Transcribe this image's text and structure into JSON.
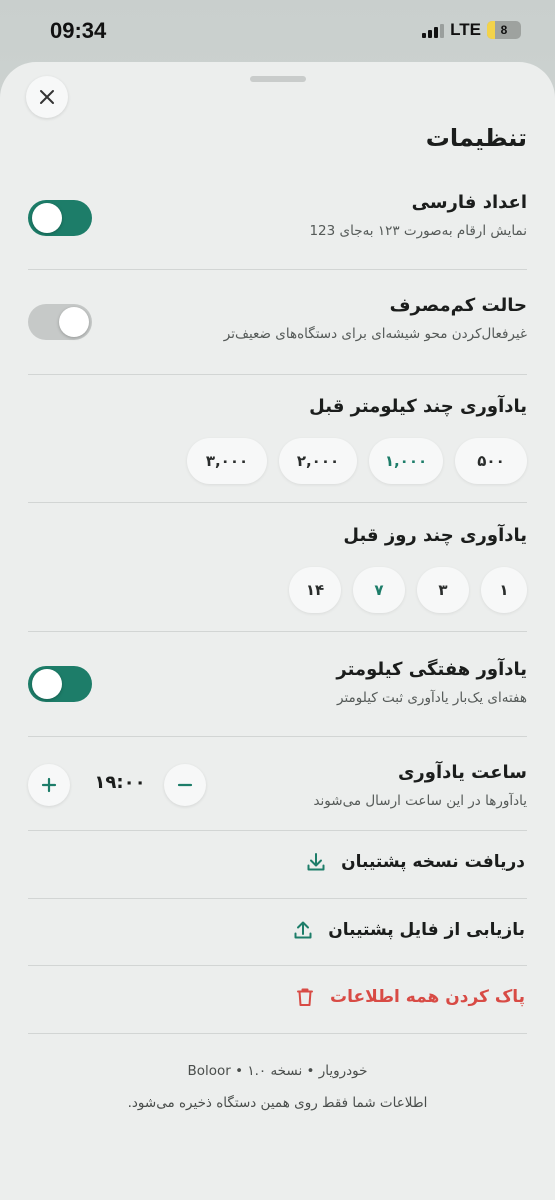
{
  "status_bar": {
    "time": "09:34",
    "network": "LTE",
    "battery": "8"
  },
  "sheet": {
    "title": "تنظیمات"
  },
  "persian_digits": {
    "label": "اعداد فارسی",
    "description": "نمایش ارقام به‌صورت ۱۲۳ به‌جای 123",
    "enabled": true
  },
  "low_power": {
    "label": "حالت کم‌مصرف",
    "description": "غیرفعال‌کردن محو شیشه‌ای برای دستگاه‌های ضعیف‌تر",
    "enabled": false
  },
  "km_reminder": {
    "label": "یادآوری چند کیلومتر قبل",
    "options": [
      "۵۰۰",
      "۱,۰۰۰",
      "۲,۰۰۰",
      "۳,۰۰۰"
    ],
    "selected": "۱,۰۰۰"
  },
  "day_reminder": {
    "label": "یادآوری چند روز قبل",
    "options": [
      "۱",
      "۳",
      "۷",
      "۱۴"
    ],
    "selected": "۷"
  },
  "weekly_km": {
    "label": "یادآور هفتگی کیلومتر",
    "description": "هفته‌ای یک‌بار یادآوری ثبت کیلومتر",
    "enabled": true
  },
  "reminder_time": {
    "label": "ساعت یادآوری",
    "description": "یادآورها در این ساعت ارسال می‌شوند",
    "value": "۱۹:۰۰"
  },
  "actions": {
    "backup": "دریافت نسخه پشتیبان",
    "restore": "بازیابی از فایل پشتیبان",
    "clear": "پاک کردن همه اطلاعات"
  },
  "footer": {
    "version": "خودرویار • نسخه ۱.۰ • Boloor",
    "note": "اطلاعات شما فقط روی همین دستگاه ذخیره می‌شود."
  },
  "colors": {
    "accent": "#1d7d69",
    "danger": "#d84b45"
  }
}
